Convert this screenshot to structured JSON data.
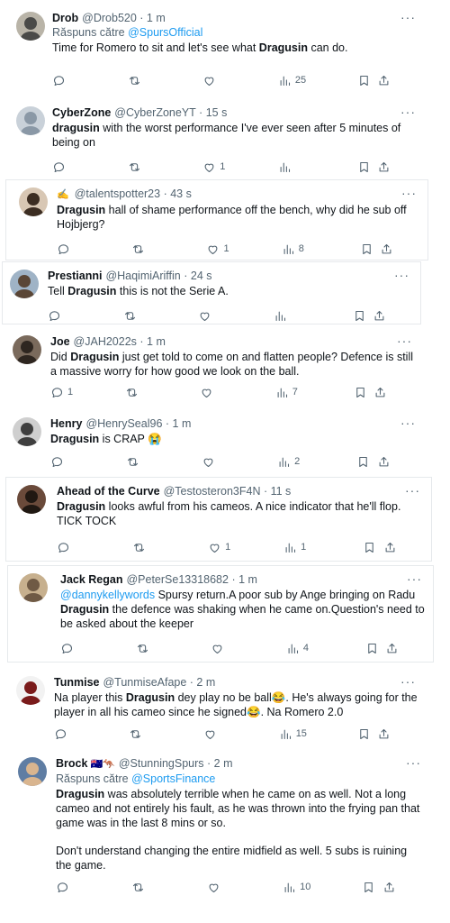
{
  "tweets": [
    {
      "name": "Drob",
      "handle": "@Drob520",
      "time": "1 m",
      "reply_prefix": "Răspuns către",
      "reply_to": "@SpursOfficial",
      "text": [
        {
          "t": "Time for Romero to sit and let's see what "
        },
        {
          "t": "Dragusin",
          "b": true
        },
        {
          "t": " can do."
        }
      ],
      "views": "25",
      "likes": "",
      "replies": ""
    },
    {
      "name": "CyberZone",
      "handle": "@CyberZoneYT",
      "time": "15 s",
      "text": [
        {
          "t": "dragusin",
          "b": true
        },
        {
          "t": " with the worst performance I've ever seen after 5 minutes of being on"
        }
      ],
      "views": "",
      "likes": "1",
      "replies": ""
    },
    {
      "name": "",
      "name_emoji": "✍",
      "handle": "@talentspotter23",
      "time": "43 s",
      "text": [
        {
          "t": "Dragusin",
          "b": true
        },
        {
          "t": " hall of shame performance off the bench, why did he sub off Hojbjerg?"
        }
      ],
      "views": "8",
      "likes": "1",
      "replies": ""
    },
    {
      "name": "Prestianni",
      "handle": "@HaqimiAriffin",
      "time": "24 s",
      "text": [
        {
          "t": "Tell "
        },
        {
          "t": "Dragusin",
          "b": true
        },
        {
          "t": " this is not the Serie A."
        }
      ],
      "views": "",
      "likes": "",
      "replies": ""
    },
    {
      "name": "Joe",
      "handle": "@JAH2022s",
      "time": "1 m",
      "text": [
        {
          "t": "Did "
        },
        {
          "t": "Dragusin",
          "b": true
        },
        {
          "t": " just get told to come on and flatten people? Defence is still a massive worry for how good we look on the ball."
        }
      ],
      "views": "7",
      "likes": "",
      "replies": "1"
    },
    {
      "name": "Henry",
      "handle": "@HenrySeal96",
      "time": "1 m",
      "text": [
        {
          "t": "Dragusin",
          "b": true
        },
        {
          "t": " is CRAP 😭"
        }
      ],
      "views": "2",
      "likes": "",
      "replies": ""
    },
    {
      "name": "Ahead of the Curve",
      "handle": "@Testosteron3F4N",
      "time": "11 s",
      "text": [
        {
          "t": "Dragusin",
          "b": true
        },
        {
          "t": " looks awful from his cameos. A nice indicator that he'll flop. TICK TOCK"
        }
      ],
      "views": "1",
      "likes": "1",
      "replies": ""
    },
    {
      "name": "Jack Regan",
      "handle": "@PeterSe13318682",
      "time": "1 m",
      "text": [
        {
          "t": "@dannykellywords",
          "m": true
        },
        {
          "t": " Spursy return.A poor sub by Ange bringing on Radu "
        },
        {
          "t": "Dragusin",
          "b": true
        },
        {
          "t": " the defence was shaking when he came on.Question's need to be asked about the keeper"
        }
      ],
      "views": "4",
      "likes": "",
      "replies": ""
    },
    {
      "name": "Tunmise",
      "handle": "@TunmiseAfape",
      "time": "2 m",
      "text": [
        {
          "t": "Na player this "
        },
        {
          "t": "Dragusin",
          "b": true
        },
        {
          "t": " dey play no be ball😂. He's always going for the player in all his cameo since he signed😂. Na Romero 2.0"
        }
      ],
      "views": "15",
      "likes": "",
      "replies": ""
    },
    {
      "name": "Brock",
      "name_emoji": "🇦🇺🦘",
      "handle": "@StunningSpurs",
      "time": "2 m",
      "reply_prefix": "Răspuns către",
      "reply_to": "@SportsFinance",
      "text": [
        {
          "t": "Dragusin",
          "b": true
        },
        {
          "t": " was absolutely terrible when he came on as well. Not a long cameo and not entirely his fault, as he was thrown into the frying pan that game was in the last 8 mins or so."
        }
      ],
      "text2": "Don't understand changing the entire midfield as well. 5 subs is ruining the game.",
      "views": "10",
      "likes": "",
      "replies": ""
    }
  ],
  "colors": {
    "accent": "#1d9bf0",
    "muted": "#536471",
    "text": "#0f1419",
    "border": "#e6e9ec"
  },
  "icons": {
    "reply": "reply-icon",
    "retweet": "retweet-icon",
    "like": "heart-icon",
    "views": "views-icon",
    "bookmark": "bookmark-icon",
    "share": "share-icon",
    "more": "more-icon"
  }
}
